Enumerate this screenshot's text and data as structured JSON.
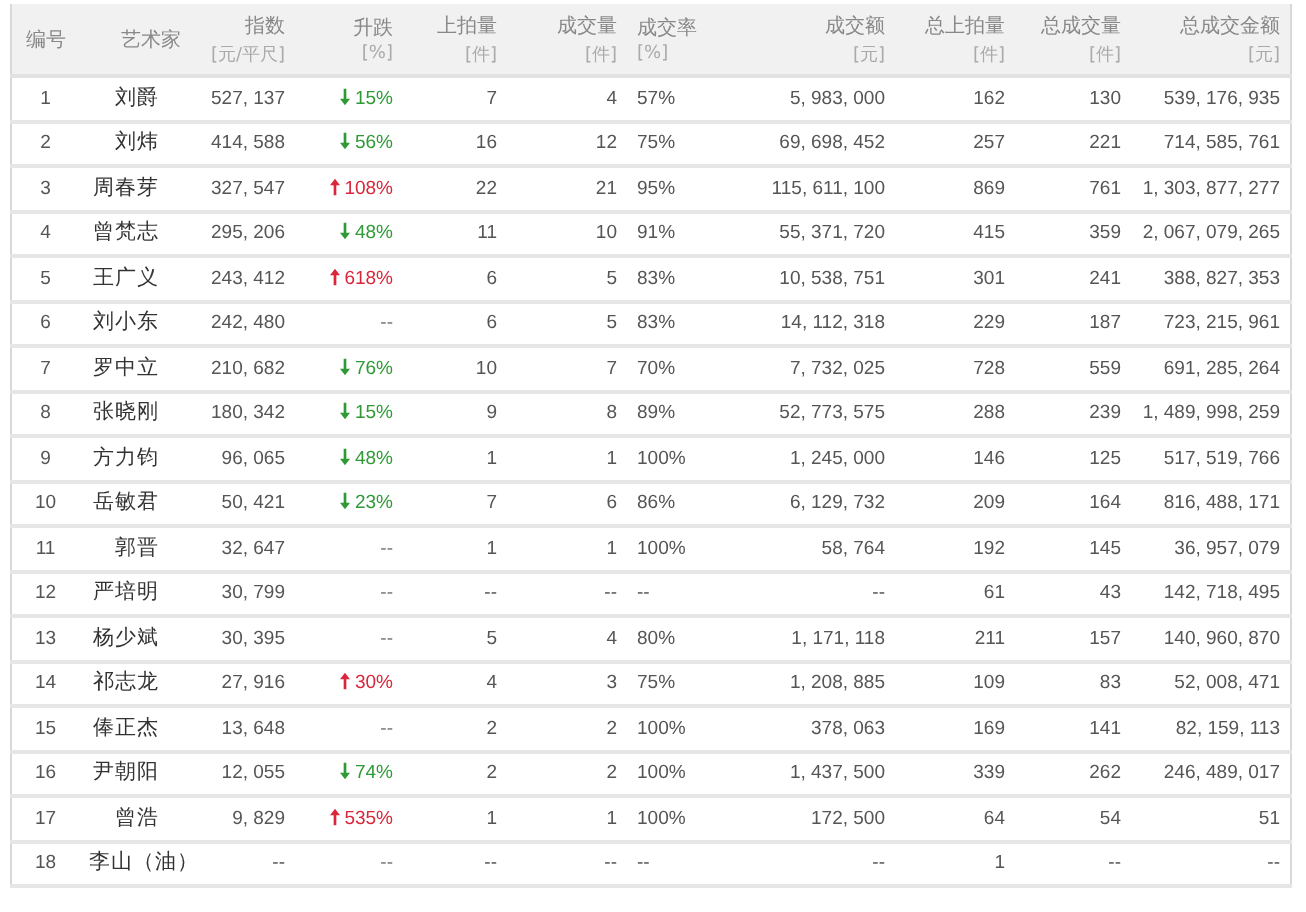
{
  "table": {
    "columns": [
      {
        "title": "编号"
      },
      {
        "title": "艺术家"
      },
      {
        "title": "指数",
        "unit": "[元/平尺]"
      },
      {
        "title": "升跌",
        "unit": "[%]"
      },
      {
        "title": "上拍量",
        "unit": "[件]"
      },
      {
        "title": "成交量",
        "unit": "[件]"
      },
      {
        "title": "成交率",
        "unit": "[%]"
      },
      {
        "title": "成交额",
        "unit": "[元]"
      },
      {
        "title": "总上拍量",
        "unit": "[件]"
      },
      {
        "title": "总成交量",
        "unit": "[件]"
      },
      {
        "title": "总成交金额",
        "unit": "[元]"
      }
    ],
    "rows": [
      {
        "no": "1",
        "artist": "刘爵",
        "index": "527, 137",
        "change": {
          "kind": "down",
          "text": "15%"
        },
        "listed": "7",
        "sold": "4",
        "rate": "57%",
        "amount": "5, 983, 000",
        "total_listed": "162",
        "total_sold": "130",
        "total_amount": "539, 176, 935"
      },
      {
        "no": "2",
        "artist": "刘炜",
        "index": "414, 588",
        "change": {
          "kind": "down",
          "text": "56%"
        },
        "listed": "16",
        "sold": "12",
        "rate": "75%",
        "amount": "69, 698, 452",
        "total_listed": "257",
        "total_sold": "221",
        "total_amount": "714, 585, 761"
      },
      {
        "no": "3",
        "artist": "周春芽",
        "index": "327, 547",
        "change": {
          "kind": "up",
          "text": "108%"
        },
        "listed": "22",
        "sold": "21",
        "rate": "95%",
        "amount": "115, 611, 100",
        "total_listed": "869",
        "total_sold": "761",
        "total_amount": "1, 303, 877, 277"
      },
      {
        "no": "4",
        "artist": "曾梵志",
        "index": "295, 206",
        "change": {
          "kind": "down",
          "text": "48%"
        },
        "listed": "11",
        "sold": "10",
        "rate": "91%",
        "amount": "55, 371, 720",
        "total_listed": "415",
        "total_sold": "359",
        "total_amount": "2, 067, 079, 265"
      },
      {
        "no": "5",
        "artist": "王广义",
        "index": "243, 412",
        "change": {
          "kind": "up",
          "text": "618%"
        },
        "listed": "6",
        "sold": "5",
        "rate": "83%",
        "amount": "10, 538, 751",
        "total_listed": "301",
        "total_sold": "241",
        "total_amount": "388, 827, 353"
      },
      {
        "no": "6",
        "artist": "刘小东",
        "index": "242, 480",
        "change": {
          "kind": "none",
          "text": "--"
        },
        "listed": "6",
        "sold": "5",
        "rate": "83%",
        "amount": "14, 112, 318",
        "total_listed": "229",
        "total_sold": "187",
        "total_amount": "723, 215, 961"
      },
      {
        "no": "7",
        "artist": "罗中立",
        "index": "210, 682",
        "change": {
          "kind": "down",
          "text": "76%"
        },
        "listed": "10",
        "sold": "7",
        "rate": "70%",
        "amount": "7, 732, 025",
        "total_listed": "728",
        "total_sold": "559",
        "total_amount": "691, 285, 264"
      },
      {
        "no": "8",
        "artist": "张晓刚",
        "index": "180, 342",
        "change": {
          "kind": "down",
          "text": "15%"
        },
        "listed": "9",
        "sold": "8",
        "rate": "89%",
        "amount": "52, 773, 575",
        "total_listed": "288",
        "total_sold": "239",
        "total_amount": "1, 489, 998, 259"
      },
      {
        "no": "9",
        "artist": "方力钧",
        "index": "96, 065",
        "change": {
          "kind": "down",
          "text": "48%"
        },
        "listed": "1",
        "sold": "1",
        "rate": "100%",
        "amount": "1, 245, 000",
        "total_listed": "146",
        "total_sold": "125",
        "total_amount": "517, 519, 766"
      },
      {
        "no": "10",
        "artist": "岳敏君",
        "index": "50, 421",
        "change": {
          "kind": "down",
          "text": "23%"
        },
        "listed": "7",
        "sold": "6",
        "rate": "86%",
        "amount": "6, 129, 732",
        "total_listed": "209",
        "total_sold": "164",
        "total_amount": "816, 488, 171"
      },
      {
        "no": "11",
        "artist": "郭晋",
        "index": "32, 647",
        "change": {
          "kind": "none",
          "text": "--"
        },
        "listed": "1",
        "sold": "1",
        "rate": "100%",
        "amount": "58, 764",
        "total_listed": "192",
        "total_sold": "145",
        "total_amount": "36, 957, 079"
      },
      {
        "no": "12",
        "artist": "严培明",
        "index": "30, 799",
        "change": {
          "kind": "none",
          "text": "--"
        },
        "listed": "--",
        "sold": "--",
        "rate": "--",
        "amount": "--",
        "total_listed": "61",
        "total_sold": "43",
        "total_amount": "142, 718, 495"
      },
      {
        "no": "13",
        "artist": "杨少斌",
        "index": "30, 395",
        "change": {
          "kind": "none",
          "text": "--"
        },
        "listed": "5",
        "sold": "4",
        "rate": "80%",
        "amount": "1, 171, 118",
        "total_listed": "211",
        "total_sold": "157",
        "total_amount": "140, 960, 870"
      },
      {
        "no": "14",
        "artist": "祁志龙",
        "index": "27, 916",
        "change": {
          "kind": "up",
          "text": "30%"
        },
        "listed": "4",
        "sold": "3",
        "rate": "75%",
        "amount": "1, 208, 885",
        "total_listed": "109",
        "total_sold": "83",
        "total_amount": "52, 008, 471"
      },
      {
        "no": "15",
        "artist": "俸正杰",
        "index": "13, 648",
        "change": {
          "kind": "none",
          "text": "--"
        },
        "listed": "2",
        "sold": "2",
        "rate": "100%",
        "amount": "378, 063",
        "total_listed": "169",
        "total_sold": "141",
        "total_amount": "82, 159, 113"
      },
      {
        "no": "16",
        "artist": "尹朝阳",
        "index": "12, 055",
        "change": {
          "kind": "down",
          "text": "74%"
        },
        "listed": "2",
        "sold": "2",
        "rate": "100%",
        "amount": "1, 437, 500",
        "total_listed": "339",
        "total_sold": "262",
        "total_amount": "246, 489, 017"
      },
      {
        "no": "17",
        "artist": "曾浩",
        "index": "9, 829",
        "change": {
          "kind": "up",
          "text": "535%"
        },
        "listed": "1",
        "sold": "1",
        "rate": "100%",
        "amount": "172, 500",
        "total_listed": "64",
        "total_sold": "54",
        "total_amount": "51"
      },
      {
        "no": "18",
        "artist": "李山（油）",
        "index": "--",
        "change": {
          "kind": "none",
          "text": "--"
        },
        "listed": "--",
        "sold": "--",
        "rate": "--",
        "amount": "--",
        "total_listed": "1",
        "total_sold": "--",
        "total_amount": "--"
      }
    ]
  }
}
